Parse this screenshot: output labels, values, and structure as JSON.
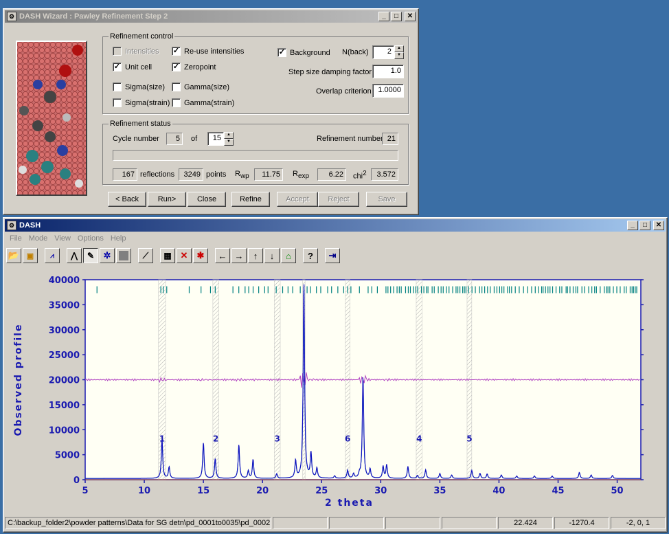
{
  "wizard": {
    "title": "DASH Wizard : Pawley Refinement Step 2",
    "refinement_control": {
      "group_title": "Refinement control",
      "intensities": {
        "label": "Intensities",
        "checked": false,
        "disabled": true
      },
      "reuse_intensities": {
        "label": "Re-use intensities",
        "checked": true
      },
      "unit_cell": {
        "label": "Unit cell",
        "checked": true
      },
      "zeropoint": {
        "label": "Zeropoint",
        "checked": true
      },
      "sigma_size": {
        "label": "Sigma(size)",
        "checked": false
      },
      "gamma_size": {
        "label": "Gamma(size)",
        "checked": false
      },
      "sigma_strain": {
        "label": "Sigma(strain)",
        "checked": false
      },
      "gamma_strain": {
        "label": "Gamma(strain)",
        "checked": false
      },
      "background": {
        "label": "Background",
        "checked": true
      },
      "nback_label": "N(back)",
      "nback_value": "2",
      "damping_label": "Step size damping factor",
      "damping_value": "1.0",
      "overlap_label": "Overlap criterion",
      "overlap_value": "1.0000"
    },
    "refinement_status": {
      "group_title": "Refinement status",
      "cycle_label": "Cycle number",
      "cycle_value": "5",
      "of_label": "of",
      "cycle_total": "15",
      "refnum_label": "Refinement number",
      "refnum_value": "21",
      "reflections_value": "167",
      "reflections_label": "reflections",
      "points_value": "3249",
      "points_label": "points",
      "rwp_label": "R",
      "rwp_sub": "wp",
      "rwp_value": "11.75",
      "rexp_label": "R",
      "rexp_sub": "exp",
      "rexp_value": "6.22",
      "chi_label": "chi",
      "chi_sup": "2",
      "chi_value": "3.572"
    },
    "buttons": {
      "back": "< Back",
      "run": "Run>",
      "close": "Close",
      "refine": "Refine",
      "accept": "Accept",
      "reject": "Reject",
      "save": "Save"
    }
  },
  "main": {
    "title": "DASH",
    "menu": [
      "File",
      "Mode",
      "View",
      "Options",
      "Help"
    ],
    "toolbar_icons": [
      "open-icon",
      "save-icon",
      "spectrum-icon",
      "peak-fit-icon",
      "pencil-icon",
      "settings-star-icon",
      "stop-icon",
      "wand-icon",
      "grid-icon",
      "delete-x-icon",
      "bug-icon",
      "arrow-left-icon",
      "arrow-right-icon",
      "arrow-up-icon",
      "arrow-down-icon",
      "home-icon",
      "help-icon",
      "exit-icon"
    ],
    "status": {
      "path": "C:\\backup_folder2\\powder patterns\\Data for SG detn\\pd_0001to0035\\pd_0002",
      "x": "22.424",
      "y": "-1270.4",
      "hkl": "-2, 0, 1"
    }
  },
  "chart_data": {
    "type": "line",
    "xlabel": "2 theta",
    "ylabel": "Observed profile",
    "xlim": [
      5,
      52
    ],
    "ylim": [
      0,
      40000
    ],
    "xticks": [
      5,
      10,
      15,
      20,
      25,
      30,
      35,
      40,
      45,
      50
    ],
    "yticks": [
      0,
      5000,
      10000,
      15000,
      20000,
      25000,
      30000,
      35000,
      40000
    ],
    "difference_offset": 20000,
    "peaks": [
      {
        "x": 11.5,
        "y": 7800
      },
      {
        "x": 12.1,
        "y": 2300
      },
      {
        "x": 15.0,
        "y": 7200
      },
      {
        "x": 16.0,
        "y": 4000
      },
      {
        "x": 18.0,
        "y": 6800
      },
      {
        "x": 18.8,
        "y": 1500
      },
      {
        "x": 19.2,
        "y": 3800
      },
      {
        "x": 21.2,
        "y": 900
      },
      {
        "x": 22.8,
        "y": 3500
      },
      {
        "x": 23.5,
        "y": 39500
      },
      {
        "x": 24.1,
        "y": 5000
      },
      {
        "x": 24.6,
        "y": 2000
      },
      {
        "x": 26.1,
        "y": 500
      },
      {
        "x": 27.2,
        "y": 1600
      },
      {
        "x": 27.7,
        "y": 900
      },
      {
        "x": 28.2,
        "y": 700
      },
      {
        "x": 28.5,
        "y": 20500
      },
      {
        "x": 29.1,
        "y": 1800
      },
      {
        "x": 30.2,
        "y": 2400
      },
      {
        "x": 30.5,
        "y": 2700
      },
      {
        "x": 32.3,
        "y": 2400
      },
      {
        "x": 33.1,
        "y": 600
      },
      {
        "x": 33.8,
        "y": 1700
      },
      {
        "x": 35.0,
        "y": 1000
      },
      {
        "x": 36.0,
        "y": 700
      },
      {
        "x": 37.7,
        "y": 1600
      },
      {
        "x": 38.4,
        "y": 1000
      },
      {
        "x": 39.0,
        "y": 900
      },
      {
        "x": 40.2,
        "y": 700
      },
      {
        "x": 41.5,
        "y": 500
      },
      {
        "x": 43.0,
        "y": 500
      },
      {
        "x": 44.5,
        "y": 500
      },
      {
        "x": 46.8,
        "y": 1200
      },
      {
        "x": 47.8,
        "y": 700
      },
      {
        "x": 49.6,
        "y": 600
      }
    ],
    "excluded_regions": [
      {
        "label": "1",
        "x": [
          11.2,
          11.8
        ]
      },
      {
        "label": "2",
        "x": [
          15.8,
          16.3
        ]
      },
      {
        "label": "3",
        "x": [
          21.0,
          21.5
        ]
      },
      {
        "label": "",
        "x": [
          23.4,
          23.6
        ]
      },
      {
        "label": "6",
        "x": [
          27.0,
          27.4
        ]
      },
      {
        "label": "4",
        "x": [
          33.0,
          33.5
        ]
      },
      {
        "label": "5",
        "x": [
          37.3,
          37.7
        ]
      }
    ],
    "reflection_ticks_y": 38000
  }
}
